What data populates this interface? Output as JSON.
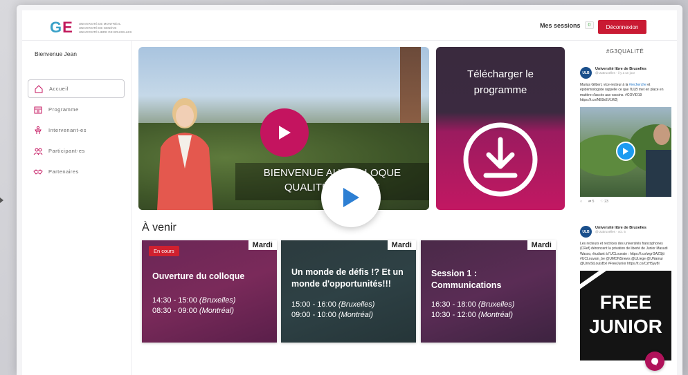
{
  "header": {
    "logo_mark": "GE",
    "logo_lines": [
      "UNIVERSITÉ DE MONTRÉAL",
      "UNIVERSITÉ DE GENÈVE",
      "UNIVERSITÉ LIBRE DE BRUXELLES"
    ],
    "sessions_label": "Mes sessions",
    "sessions_count": "0",
    "logout_label": "Déconnexion"
  },
  "sidebar": {
    "welcome": "Bienvenue Jean",
    "items": [
      {
        "label": "Accueil",
        "icon": "home-icon",
        "active": true
      },
      {
        "label": "Programme",
        "icon": "calendar-icon"
      },
      {
        "label": "Intervenant-es",
        "icon": "podium-icon"
      },
      {
        "label": "Participant-es",
        "icon": "people-icon"
      },
      {
        "label": "Partenaires",
        "icon": "handshake-icon"
      }
    ]
  },
  "main": {
    "video": {
      "caption_line1": "BIENVENUE AU COLLOQUE",
      "caption_line2": "QUALITÉ EN LIGNE"
    },
    "download": {
      "title_line1": "Télécharger le",
      "title_line2": "programme"
    },
    "upcoming_title": "À venir",
    "cards": [
      {
        "day": "Mardi",
        "badge": "En cours",
        "title": "Ouverture du colloque",
        "time1": "14:30 - 15:00",
        "place1": "(Bruxelles)",
        "time2": "08:30 - 09:00",
        "place2": "(Montréal)"
      },
      {
        "day": "Mardi",
        "title": "Un monde de défis !? Et un monde d'opportunités!!!",
        "time1": "15:00 - 16:00",
        "place1": "(Bruxelles)",
        "time2": "09:00 - 10:00",
        "place2": "(Montréal)"
      },
      {
        "day": "Mardi",
        "title": "Session 1 : Communications",
        "time1": "16:30 - 18:00",
        "place1": "(Bruxelles)",
        "time2": "10:30 - 12:00",
        "place2": "(Montréal)"
      }
    ]
  },
  "feed": {
    "tag": "#G3QUALITÉ",
    "tweets": [
      {
        "avatar": "ULB",
        "name": "Université libre de Bruxelles",
        "handle": "@ULBruxelles · il y a un jour",
        "text_pre": "Marius Gilbert, vice-recteur à la ",
        "text_link": "#recherche",
        "text_post": " et épidémiologiste rappelle ce que l'ULB met en place en matière d'accès aux vaccins. #COVID19 https://t.co/NE8sEVLW2j",
        "retweets": "5",
        "likes": "23"
      },
      {
        "avatar": "ULB",
        "name": "Université libre de Bruxelles",
        "handle": "@ULBruxelles · oct. 5",
        "text": "Les recteurs et rectrices des universités francophones (CRef) dénoncent la privation de liberté de Junior Masudi Wasso, étudiant à l'UCLouvain : https://t.co/wgrGAZSjti #UCLouvain_be @UMONSnews @ULiege @UNamur @UnivStLouisBxl #FreeJunior https://t.co/CzHSyy8l",
        "media_text_line1": "FREE",
        "media_text_line2": "JUNIOR"
      }
    ]
  },
  "colors": {
    "brand_pink": "#c4145f",
    "logout_red": "#c91a33",
    "badge_red": "#d0202f",
    "twitter_blue": "#1d9bf0"
  }
}
